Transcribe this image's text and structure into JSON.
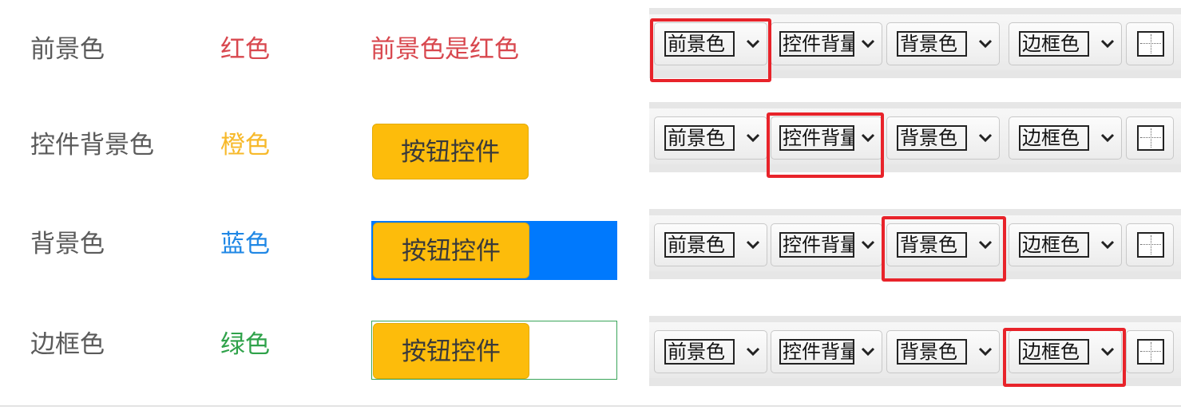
{
  "rows": [
    {
      "label": "前景色",
      "color_name": "红色",
      "color": "#d8474e",
      "demo_text": "前景色是红色"
    },
    {
      "label": "控件背景色",
      "color_name": "橙色",
      "color": "#f7b92a",
      "button_label": "按钮控件"
    },
    {
      "label": "背景色",
      "color_name": "蓝色",
      "color": "#1f87e5",
      "button_label": "按钮控件",
      "background_color": "#0079fd"
    },
    {
      "label": "边框色",
      "color_name": "绿色",
      "color": "#2fa24a",
      "button_label": "按钮控件",
      "border_color": "#3aa55a"
    }
  ],
  "toolbar": {
    "dropdowns": [
      "前景色",
      "控件背量",
      "背景色",
      "边框色"
    ],
    "grid_icon": "table-grid-icon",
    "chevron_icon": "chevron-down-icon",
    "highlight_color": "#e8232a"
  }
}
